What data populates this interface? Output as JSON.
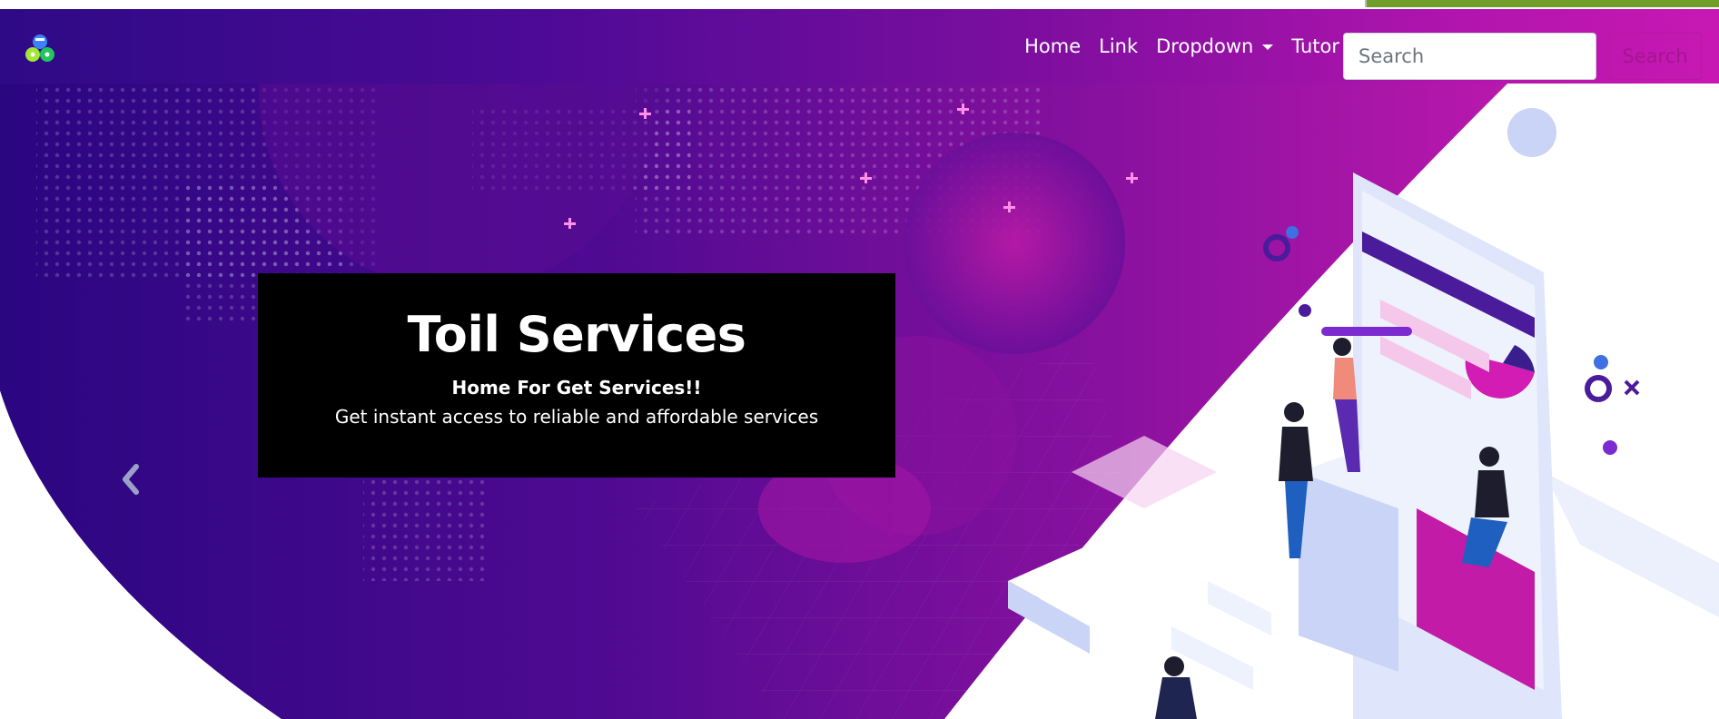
{
  "navbar": {
    "brand_icon": "brand-logo-icon",
    "links": [
      {
        "label": "Home"
      },
      {
        "label": "Link"
      },
      {
        "label": "Dropdown"
      },
      {
        "label": "Tutor"
      }
    ],
    "search": {
      "placeholder": "Search",
      "button_label": "Search"
    }
  },
  "carousel": {
    "caption": {
      "title": "Toil Services",
      "subtitle": "Home For Get Services!!",
      "text": "Get instant access to reliable and affordable services"
    },
    "prev_icon": "chevron-left-icon"
  },
  "colors": {
    "nav_gradient_start": "#2e0a86",
    "nav_gradient_end": "#c818b3",
    "accent": "#b8189f",
    "caption_bg": "#000000"
  }
}
